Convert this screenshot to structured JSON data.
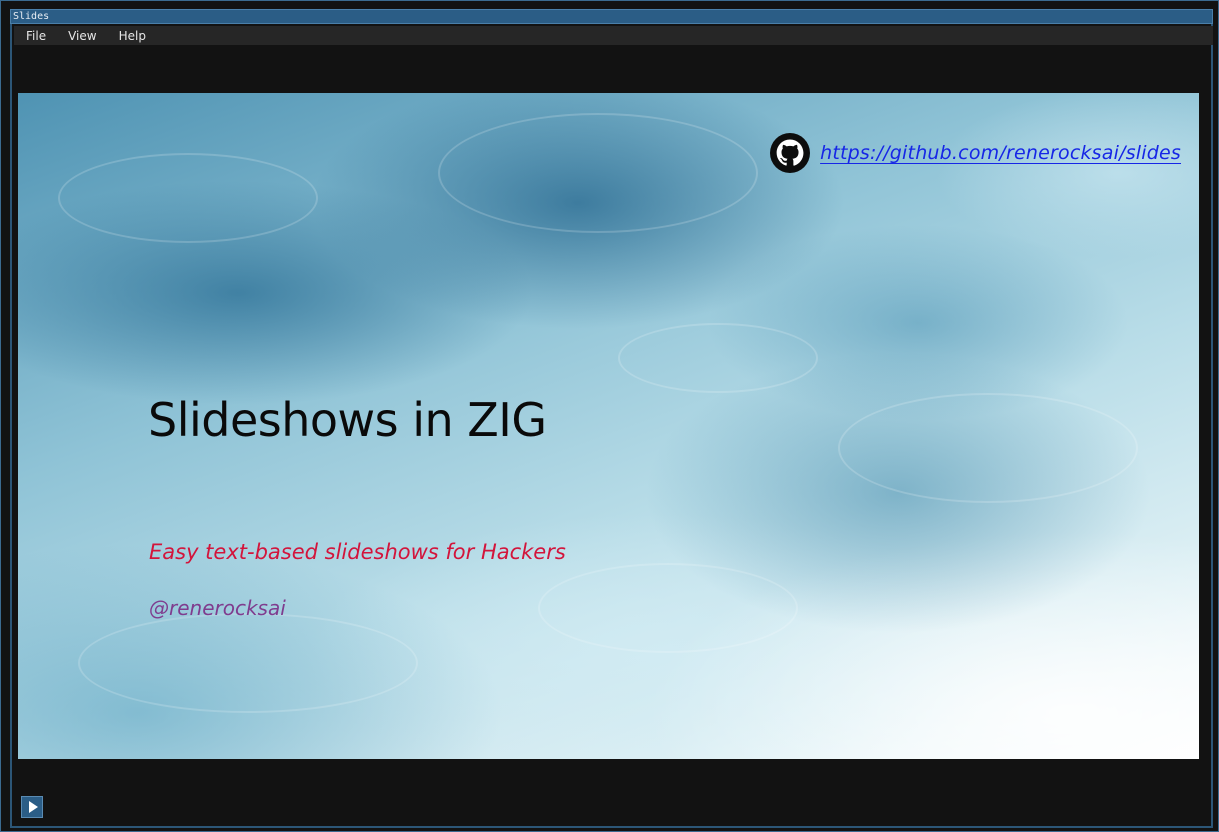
{
  "window": {
    "title": "Slides"
  },
  "menu": {
    "items": [
      {
        "label": "File"
      },
      {
        "label": "View"
      },
      {
        "label": "Help"
      }
    ]
  },
  "slide": {
    "link_url": "https://github.com/renerocksai/slides",
    "link_icon": "github-icon",
    "title": "Slideshows in ZIG",
    "subtitle": "Easy text-based slideshows for Hackers",
    "author": "@renerocksai"
  },
  "controls": {
    "play_icon": "play-icon"
  },
  "colors": {
    "title_bar": "#2b5d86",
    "menu_bar": "#262626",
    "background": "#121212",
    "link": "#1626e6",
    "subtitle": "#d3143b",
    "author": "#7f3c8e"
  }
}
